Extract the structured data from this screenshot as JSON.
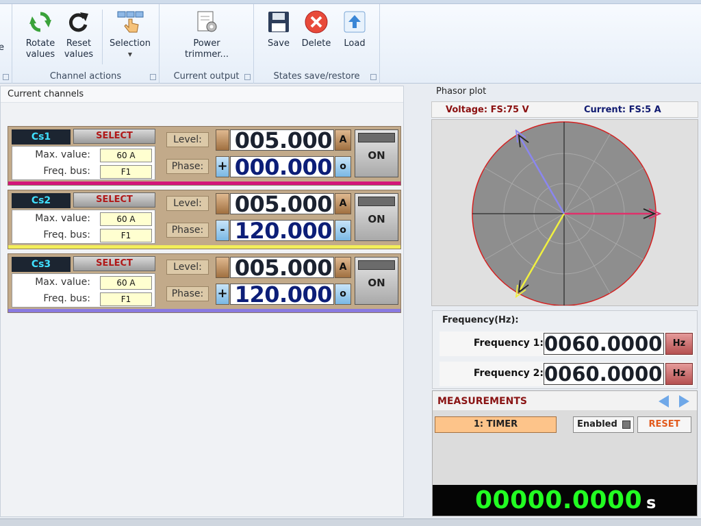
{
  "ribbon": {
    "partial_label": "e",
    "groups": {
      "channel_actions": {
        "label": "Channel actions",
        "rotate_label": "Rotate\nvalues",
        "reset_label": "Reset\nvalues",
        "selection_label": "Selection"
      },
      "current_output": {
        "label": "Current output",
        "power_trimmer_label": "Power\ntrimmer..."
      },
      "states": {
        "label": "States save/restore",
        "save_label": "Save",
        "delete_label": "Delete",
        "load_label": "Load"
      }
    }
  },
  "left_panel": {
    "title": "Current channels",
    "channels": [
      {
        "name": "Cs1",
        "select_label": "SELECT",
        "max_label": "Max. value:",
        "max_value": "60 A",
        "freq_label": "Freq. bus:",
        "freq_value": "F1",
        "level_tag": "Level:",
        "level_sign": "",
        "level_value": "005.000",
        "level_unit": "A",
        "phase_tag": "Phase:",
        "phase_sign": "+",
        "phase_value": "000.000",
        "phase_unit": "o",
        "on_label": "ON",
        "color": "#d4157a"
      },
      {
        "name": "Cs2",
        "select_label": "SELECT",
        "max_label": "Max. value:",
        "max_value": "60 A",
        "freq_label": "Freq. bus:",
        "freq_value": "F1",
        "level_tag": "Level:",
        "level_sign": "",
        "level_value": "005.000",
        "level_unit": "A",
        "phase_tag": "Phase:",
        "phase_sign": "-",
        "phase_value": "120.000",
        "phase_unit": "o",
        "on_label": "ON",
        "color": "#f2ee5a"
      },
      {
        "name": "Cs3",
        "select_label": "SELECT",
        "max_label": "Max. value:",
        "max_value": "60 A",
        "freq_label": "Freq. bus:",
        "freq_value": "F1",
        "level_tag": "Level:",
        "level_sign": "",
        "level_value": "005.000",
        "level_unit": "A",
        "phase_tag": "Phase:",
        "phase_sign": "+",
        "phase_value": "120.000",
        "phase_unit": "o",
        "on_label": "ON",
        "color": "#8a7ae0"
      }
    ]
  },
  "phasor": {
    "title": "Phasor plot",
    "voltage_label": "Voltage: FS:75 V",
    "current_label": "Current: FS:5 A",
    "vectors": [
      {
        "channel": "Cs1",
        "angle_deg": 0,
        "magnitude": 1.0,
        "color": "#e0306a"
      },
      {
        "channel": "Cs2",
        "angle_deg": -120,
        "magnitude": 1.0,
        "color": "#f0f040"
      },
      {
        "channel": "Cs3",
        "angle_deg": 120,
        "magnitude": 1.0,
        "color": "#8a86f0"
      }
    ]
  },
  "frequency": {
    "title": "Frequency(Hz):",
    "rows": [
      {
        "label": "Frequency 1:",
        "value": "0060.0000",
        "unit": "Hz"
      },
      {
        "label": "Frequency 2:",
        "value": "0060.0000",
        "unit": "Hz"
      }
    ]
  },
  "measurements": {
    "title": "MEASUREMENTS",
    "timer_label": "1: TIMER",
    "enabled_label": "Enabled",
    "reset_label": "RESET",
    "timer_value": "00000.0000",
    "timer_unit": "s"
  }
}
